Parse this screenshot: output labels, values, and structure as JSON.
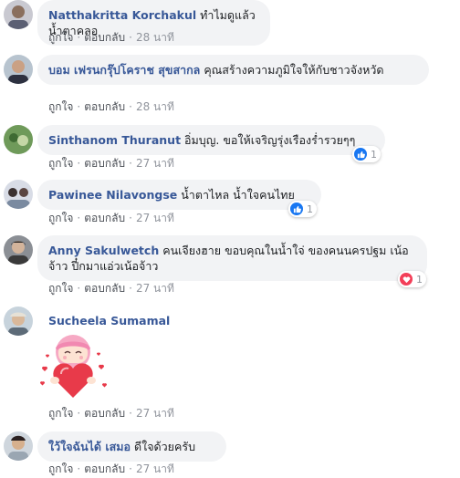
{
  "actions": {
    "like": "ถูกใจ",
    "reply": "ตอบกลับ"
  },
  "comments": [
    {
      "name": "Natthakritta Korchakul",
      "text": "ทำไมดูแล้วน้ำตาคลอ",
      "time": "28 นาที"
    },
    {
      "name": "บอม เฟรนกรุ๊ปโคราช สุขสากล",
      "text": "คุณสร้างความภูมิใจให้กับชาวจังหวัด",
      "time": "28 นาที"
    },
    {
      "name": "Sinthanom Thuranut",
      "text": "อิ่มบุญ. ขอให้เจริญรุ่งเรืองร่ำรวยๆๆ",
      "time": "27 นาที",
      "reaction": {
        "icon": "like-icon",
        "count": "1"
      }
    },
    {
      "name": "Pawinee Nilavongse",
      "text": "น้ำตาไหล น้ำใจคนไทย",
      "time": "27 นาที",
      "reaction": {
        "icon": "like-icon",
        "count": "1"
      }
    },
    {
      "name": "Anny Sakulwetch",
      "text": "คนเจียงฮาย ขอบคุณในน้ำใจ่ ของคนนครปฐม เน้อจ้าว ปี๋กมาแอ่วเน้อจ้าว",
      "time": "27 นาที",
      "reaction": {
        "icon": "heart-icon",
        "count": "1"
      }
    },
    {
      "name": "Sucheela Sumamal",
      "text": "",
      "time": "27 นาที",
      "sticker": "heart-hug-sticker"
    },
    {
      "name": "ใว้ใจฉันได้ เสมอ",
      "text": "ดีใจด้วยครับ",
      "time": "27 นาที"
    }
  ],
  "colors": {
    "name": "#385898",
    "bubble": "#f2f3f5",
    "like": "#1877f2",
    "heart": "#f33e58"
  }
}
